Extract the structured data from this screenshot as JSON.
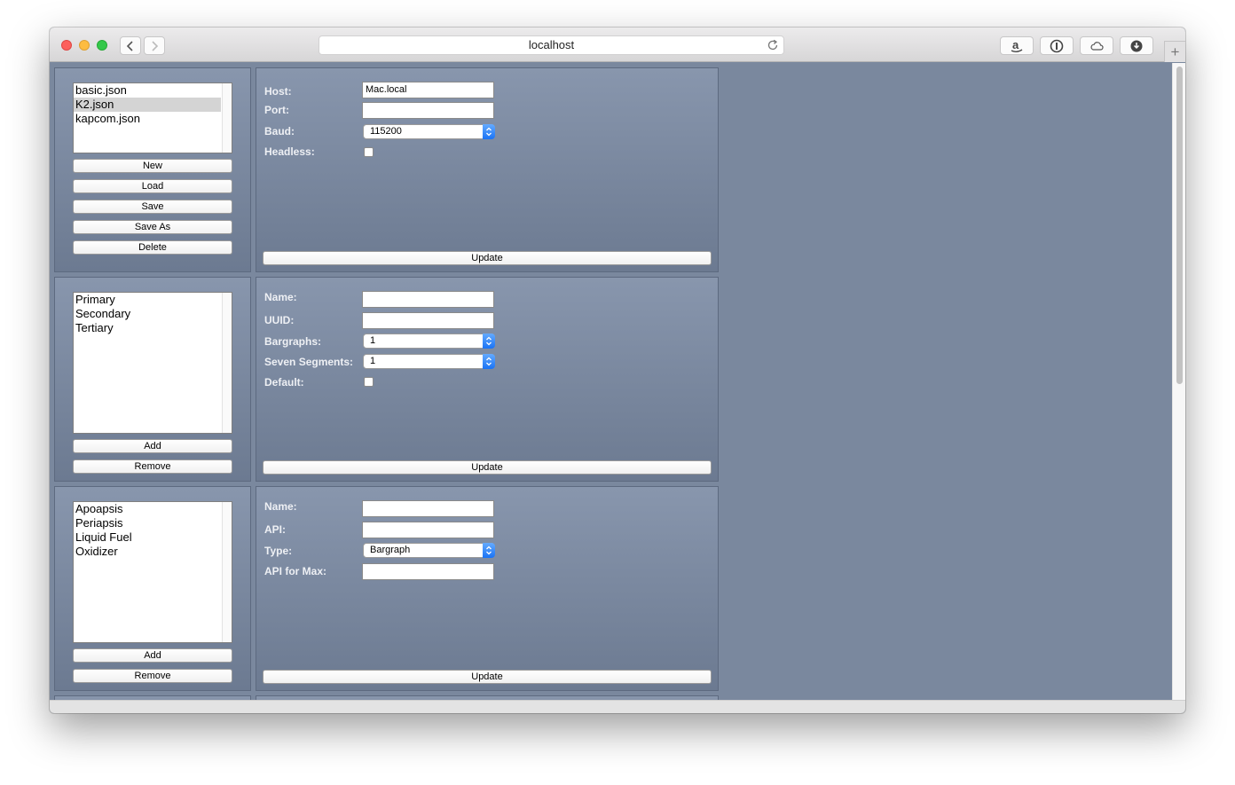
{
  "browser": {
    "address": "localhost",
    "toolbar_icons": [
      "amazon-icon",
      "password-manager-icon",
      "cloud-icon",
      "download-icon"
    ]
  },
  "section1": {
    "list": [
      "basic.json",
      "K2.json",
      "kapcom.json"
    ],
    "selected_index": 1,
    "buttons": {
      "new": "New",
      "load": "Load",
      "save": "Save",
      "save_as": "Save As",
      "delete": "Delete"
    },
    "fields": {
      "host_label": "Host:",
      "host_value": "Mac.local",
      "port_label": "Port:",
      "port_value": "",
      "baud_label": "Baud:",
      "baud_value": "115200",
      "headless_label": "Headless:"
    },
    "update": "Update"
  },
  "section2": {
    "list": [
      "Primary",
      "Secondary",
      "Tertiary"
    ],
    "buttons": {
      "add": "Add",
      "remove": "Remove"
    },
    "fields": {
      "name_label": "Name:",
      "name_value": "",
      "uuid_label": "UUID:",
      "uuid_value": "",
      "bargraphs_label": "Bargraphs:",
      "bargraphs_value": "1",
      "seven_segments_label": "Seven Segments:",
      "seven_segments_value": "1",
      "default_label": "Default:"
    },
    "update": "Update"
  },
  "section3": {
    "list": [
      "Apoapsis",
      "Periapsis",
      "Liquid Fuel",
      "Oxidizer"
    ],
    "buttons": {
      "add": "Add",
      "remove": "Remove"
    },
    "fields": {
      "name_label": "Name:",
      "name_value": "",
      "api_label": "API:",
      "api_value": "",
      "type_label": "Type:",
      "type_value": "Bargraph",
      "api_max_label": "API for Max:",
      "api_max_value": ""
    },
    "update": "Update"
  }
}
